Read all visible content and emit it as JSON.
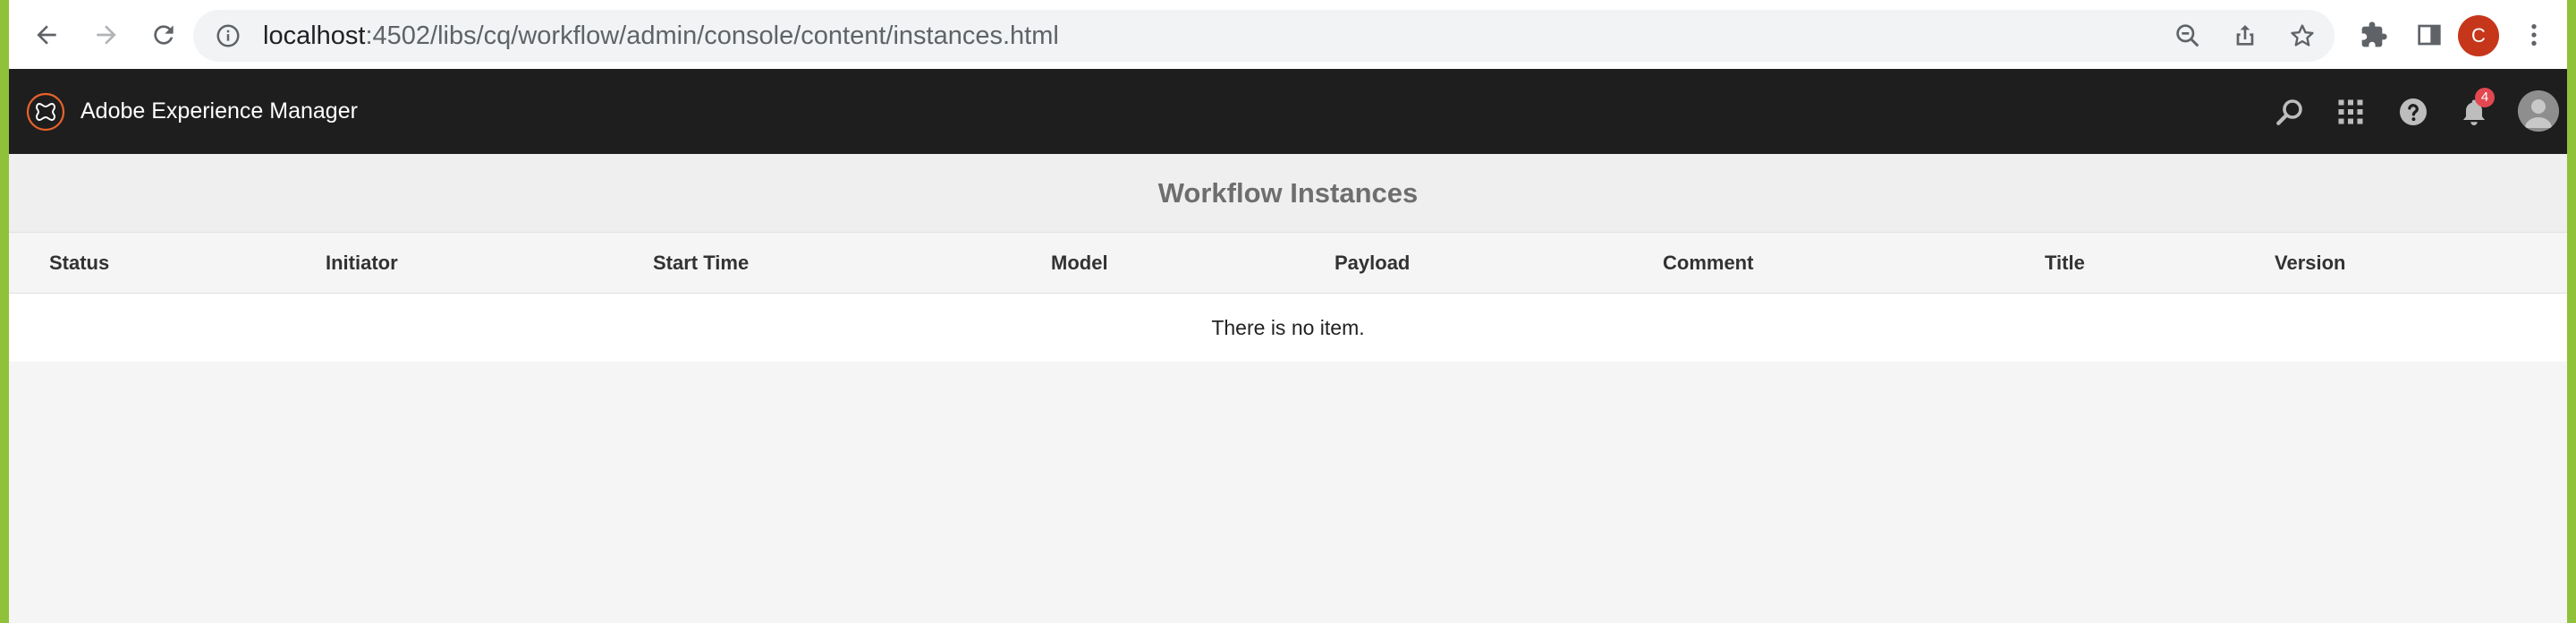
{
  "browser": {
    "url_host": "localhost",
    "url_path": ":4502/libs/cq/workflow/admin/console/content/instances.html",
    "profile_initial": "C",
    "icons": [
      "back-icon",
      "forward-icon",
      "reload-icon",
      "site-info-icon",
      "zoom-out-icon",
      "share-icon",
      "bookmark-star-icon",
      "extensions-puzzle-icon",
      "side-panel-icon",
      "kebab-menu-icon"
    ]
  },
  "aem_header": {
    "title": "Adobe Experience Manager",
    "notification_count": "4",
    "icons": [
      "aem-logo-icon",
      "search-icon",
      "solutions-grid-icon",
      "help-icon",
      "bell-icon",
      "user-avatar-icon"
    ]
  },
  "page": {
    "title": "Workflow Instances"
  },
  "table": {
    "columns": [
      "Status",
      "Initiator",
      "Start Time",
      "Model",
      "Payload",
      "Comment",
      "Title",
      "Version"
    ],
    "empty_message": "There is no item."
  },
  "colors": {
    "header_bg": "#1e1e1e",
    "page_bg": "#f5f5f5",
    "outer_frame": "#8fc23a",
    "badge": "#e34850",
    "profile": "#c5361b"
  }
}
